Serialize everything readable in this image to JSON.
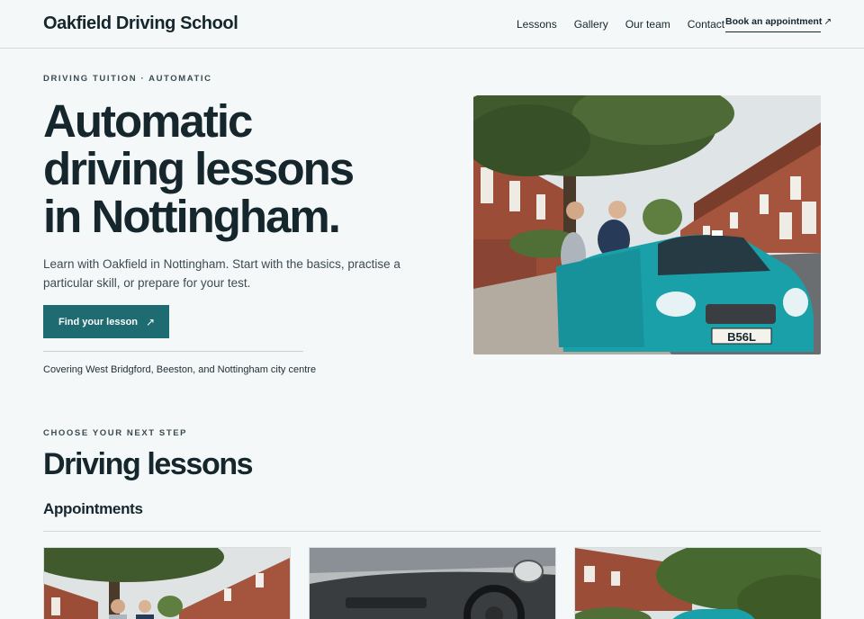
{
  "header": {
    "brand": "Oakfield Driving School",
    "nav": [
      "Lessons",
      "Gallery",
      "Our team",
      "Contact"
    ],
    "book_label": "Book an appointment",
    "book_arrow": "↗"
  },
  "hero": {
    "eyebrow": "DRIVING TUITION · AUTOMATIC",
    "title_lines": [
      "Automatic",
      "driving lessons",
      "in Nottingham."
    ],
    "subtitle": "Learn with Oakfield in Nottingham. Start with the basics, practise a particular skill, or prepare for your test.",
    "cta_label": "Find your lesson",
    "cta_arrow": "↗",
    "coverage": "Covering West Bridgford, Beeston, and Nottingham city centre",
    "plate": "B56L"
  },
  "section": {
    "eyebrow": "CHOOSE YOUR NEXT STEP",
    "title": "Driving lessons",
    "subtitle": "Appointments"
  },
  "colors": {
    "background": "#f4f8f9",
    "accent": "#1f6b72",
    "text": "#15262d"
  }
}
